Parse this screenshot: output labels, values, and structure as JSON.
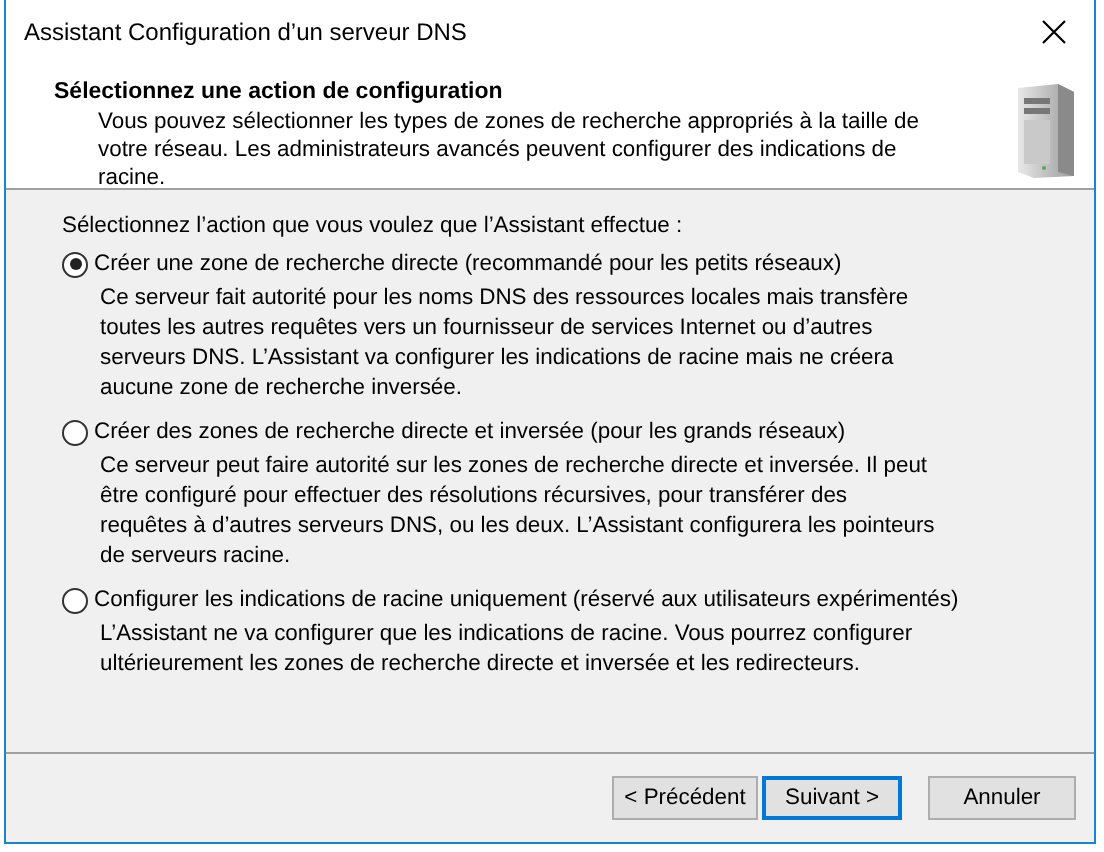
{
  "window": {
    "title": "Assistant Configuration d’un serveur DNS"
  },
  "header": {
    "title": "Sélectionnez une action de configuration",
    "description": "Vous pouvez sélectionner les types de zones de recherche appropriés à la taille de votre réseau. Les administrateurs avancés peuvent configurer des indications de racine."
  },
  "prompt": "Sélectionnez l’action que vous voulez que l’Assistant effectue :",
  "options": [
    {
      "label": "Créer une zone de recherche directe (recommandé pour les petits réseaux)",
      "selected": true,
      "description": "Ce serveur fait autorité pour les noms DNS des ressources locales mais transfère toutes les autres requêtes vers un fournisseur de services Internet ou d’autres serveurs DNS. L’Assistant va configurer les indications de racine mais ne créera aucune zone de recherche inversée."
    },
    {
      "label": "Créer des zones de recherche directe et inversée (pour les grands réseaux)",
      "selected": false,
      "description": "Ce serveur peut faire autorité sur les zones de recherche directe et inversée. Il peut être configuré pour effectuer des résolutions récursives, pour transférer des requêtes à d’autres serveurs DNS, ou les deux. L’Assistant configurera les pointeurs de serveurs racine."
    },
    {
      "label": "Configurer les indications de racine uniquement (réservé aux utilisateurs expérimentés)",
      "selected": false,
      "description": "L’Assistant ne va configurer que les indications de racine. Vous pourrez configurer ultérieurement les zones de recherche directe et inversée et les redirecteurs."
    }
  ],
  "buttons": [
    {
      "label": "< Précédent",
      "focused": false
    },
    {
      "label": "Suivant >",
      "focused": true
    },
    {
      "label": "Annuler",
      "focused": false
    }
  ]
}
